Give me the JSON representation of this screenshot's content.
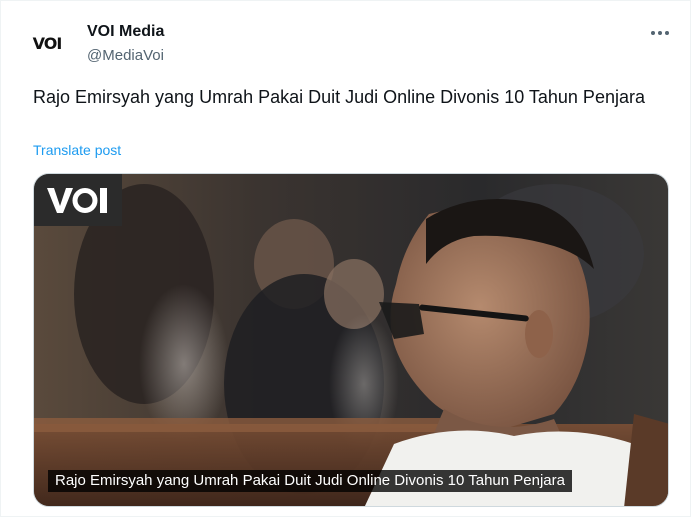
{
  "author": {
    "display_name": "VOI Media",
    "handle": "@MediaVoi",
    "avatar_text": "VOI"
  },
  "tweet": {
    "text": "Rajo Emirsyah yang Umrah Pakai Duit Judi Online Divonis 10 Tahun Penjara",
    "translate_label": "Translate post"
  },
  "media": {
    "watermark": "VOI",
    "caption": "Rajo Emirsyah yang Umrah Pakai Duit Judi Online Divonis 10 Tahun Penjara"
  },
  "icons": {
    "more": "more-horizontal-icon"
  },
  "colors": {
    "text": "#0f1419",
    "secondary": "#536471",
    "link": "#1d9bf0"
  }
}
